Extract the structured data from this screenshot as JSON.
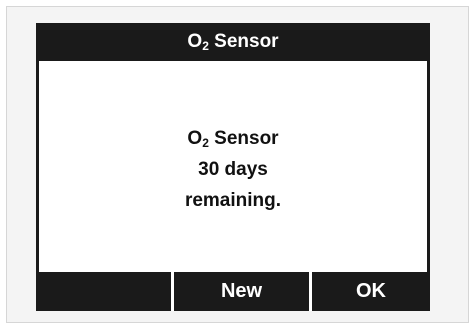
{
  "header": {
    "title_main": "O",
    "title_sub": "2",
    "title_rest": " Sensor"
  },
  "message": {
    "line1_main": "O",
    "line1_sub": "2",
    "line1_rest": " Sensor",
    "line2": "30 days",
    "line3": "remaining."
  },
  "softkeys": {
    "left": "",
    "middle": "New",
    "right": "OK"
  },
  "colors": {
    "frame": "#1a1a1a",
    "screen_bg": "#ffffff",
    "bezel": "#f4f4f4"
  }
}
